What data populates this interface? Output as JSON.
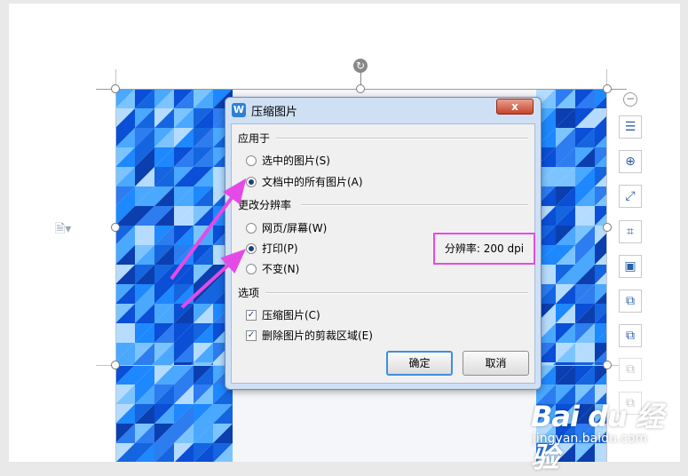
{
  "dialog": {
    "title": "压缩图片",
    "close_label": "x",
    "apply_group": {
      "label": "应用于",
      "options": [
        "选中的图片(S)",
        "文档中的所有图片(A)"
      ],
      "selected": 1
    },
    "resolution_group": {
      "label": "更改分辨率",
      "options": [
        "网页/屏幕(W)",
        "打印(P)",
        "不变(N)"
      ],
      "selected": 1,
      "resolution_text": "分辨率: 200 dpi"
    },
    "options_group": {
      "label": "选项",
      "checks": [
        {
          "label": "压缩图片(C)",
          "checked": true
        },
        {
          "label": "删除图片的剪裁区域(E)",
          "checked": true
        }
      ]
    },
    "ok_label": "确定",
    "cancel_label": "取消"
  },
  "icons": {
    "app": "wps-icon",
    "rotate": "rotate-icon",
    "side_tools": [
      "layout-icon",
      "zoom-icon",
      "crop-tool-icon",
      "crop-icon",
      "frame-icon",
      "export-icon",
      "ocr-icon",
      "convert-icon",
      "compress-icon"
    ]
  },
  "annotation_color": "#e44be6",
  "watermark": {
    "logo": "Bai du 经验",
    "url": "jingyan.baidu.com"
  }
}
